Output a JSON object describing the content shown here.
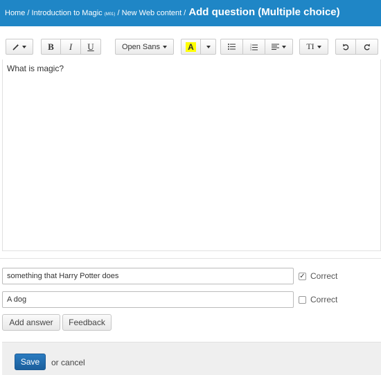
{
  "header": {
    "breadcrumb_home": "Home /",
    "breadcrumb_course": "Introduction to Magic",
    "breadcrumb_course_code": "(M01)",
    "breadcrumb_sep": "/",
    "breadcrumb_page": "New Web content /",
    "title": "Add question (Multiple choice)"
  },
  "toolbar": {
    "style_icon": "magic-wand-icon",
    "bold_label": "B",
    "italic_label": "I",
    "underline_label": "U",
    "font_label": "Open Sans",
    "highlight_label": "A",
    "highlight_color": "#ffff00",
    "bullet_icon": "unordered-list-icon",
    "numbered_icon": "ordered-list-icon",
    "align_icon": "align-left-icon",
    "textsize_label": "TI",
    "undo_icon": "undo-icon",
    "redo_icon": "redo-icon"
  },
  "editor": {
    "content": "What is magic?"
  },
  "answers": [
    {
      "value": "something that Harry Potter does",
      "correct": true,
      "correct_label": "Correct"
    },
    {
      "value": "A dog",
      "correct": false,
      "correct_label": "Correct"
    }
  ],
  "actions": {
    "add_answer_label": "Add answer",
    "feedback_label": "Feedback",
    "save_label": "Save",
    "or_label": "or",
    "cancel_label": "cancel"
  },
  "colors": {
    "header_bg": "#1f86c6",
    "save_bg": "#1b5f9c"
  }
}
